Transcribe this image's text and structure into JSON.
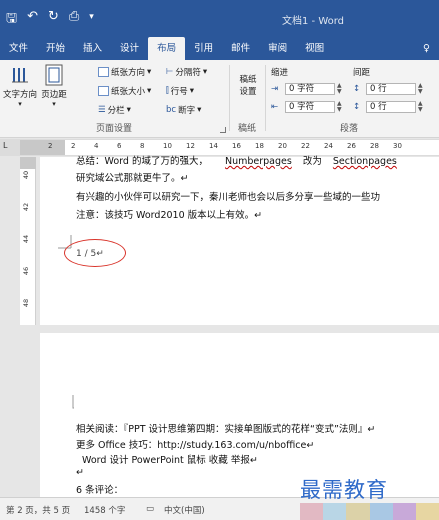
{
  "window": {
    "title": "文档1 - Word",
    "qat_icons": [
      "save-icon",
      "undo-icon",
      "redo-icon",
      "print-preview-icon",
      "customize-qat-icon"
    ]
  },
  "tabs": [
    {
      "label": "文件"
    },
    {
      "label": "开始"
    },
    {
      "label": "插入"
    },
    {
      "label": "设计"
    },
    {
      "label": "布局",
      "active": true
    },
    {
      "label": "引用"
    },
    {
      "label": "邮件"
    },
    {
      "label": "审阅"
    },
    {
      "label": "视图"
    },
    {
      "label": "♀"
    }
  ],
  "ribbon": {
    "page_setup": {
      "label": "页面设置",
      "text_direction": "文字方向",
      "margins": "页边距",
      "orientation": "纸张方向",
      "size": "纸张大小",
      "columns": "分栏",
      "breaks": "分隔符",
      "line_numbers": "行号",
      "hyphenation": "断字"
    },
    "draft_paper": {
      "label": "稿纸",
      "button": "稿纸\n设置"
    },
    "paragraph": {
      "label": "段落",
      "indent_label": "缩进",
      "spacing_label": "间距",
      "indent_left": "0 字符",
      "indent_right": "0 字符",
      "spacing_before": "0 行",
      "spacing_after": "0 行"
    }
  },
  "ruler": {
    "corner": "L",
    "ticks": [
      "2",
      "2",
      "4",
      "6",
      "8",
      "10",
      "12",
      "14",
      "16",
      "18",
      "20",
      "22",
      "24",
      "26",
      "28",
      "30"
    ],
    "vticks": [
      "40",
      "42",
      "44",
      "46",
      "48"
    ]
  },
  "document": {
    "page1": {
      "line0_prefix": "总结：Word 的域了万的强大，",
      "line0_field1": "Numberpages",
      "line0_mid": "改为",
      "line0_field2": "Sectionpages",
      "line1": "研究域公式那就更牛了。↵",
      "line2": "有兴趣的小伙伴可以研究一下，秦川老师也会以后多分享一些域的一些功",
      "line3": "注意：该技巧 Word2010 版本以上有效。↵",
      "page_number": "1 / 5↵"
    },
    "page2": {
      "line1": "相关阅读：『PPT 设计思维第四期：实接单图版式的花样“变式”法则』↵",
      "line2": "更多 Office 技巧：http://study.163.com/u/nboffice↵",
      "line3": "Word 设计 PowerPoint 鼠标 收藏  举报↵",
      "line4": "↵",
      "line5": "6 条评论："
    }
  },
  "statusbar": {
    "page": "第 2 页，共 5 页",
    "words": "1458 个字",
    "proofing_icon": "proofing-icon",
    "language": "中文(中国)"
  },
  "watermark": "最需教育",
  "colors": {
    "accent": "#2b579a",
    "annotation_circle": "#d9342b",
    "watermark": "#2f6ac9",
    "tiles": [
      "#e2b9c3",
      "#b9d6e6",
      "#dcd2a8",
      "#a9c8e4",
      "#c8a9d9",
      "#e7d6a2"
    ]
  }
}
